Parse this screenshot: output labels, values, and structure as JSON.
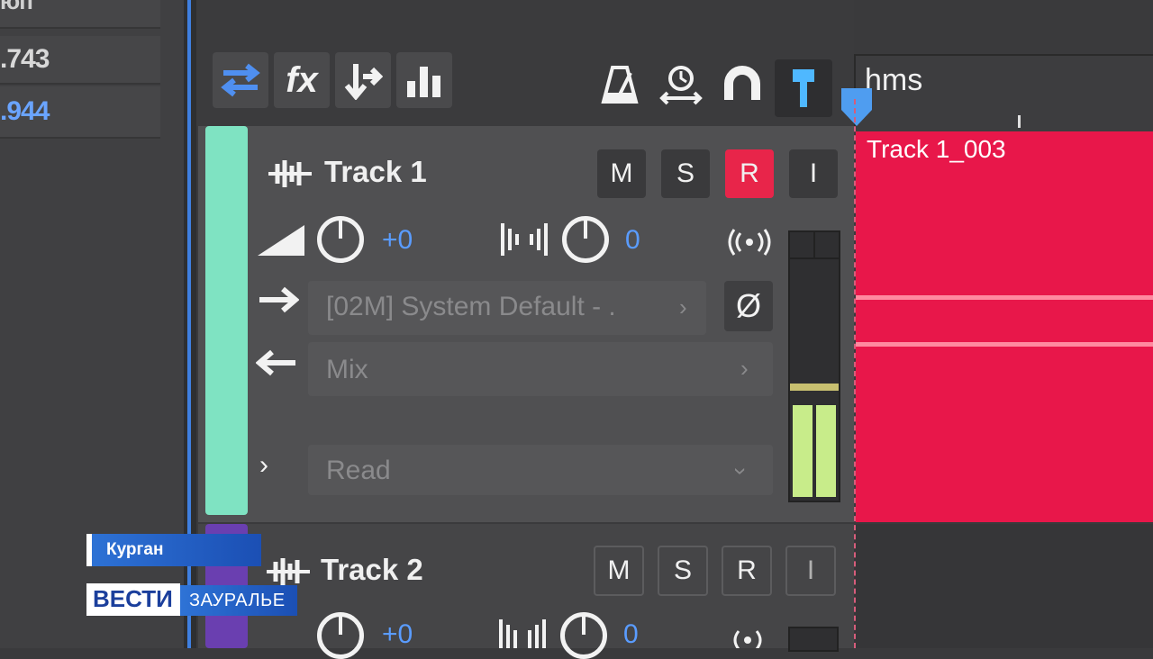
{
  "left_panel": {
    "top_fragment": "юп",
    "values": [
      ".743",
      ".944"
    ]
  },
  "toolbar": {
    "buttons": [
      "routing-icon",
      "fx-icon",
      "send-icon",
      "meter-icon"
    ],
    "fx_label": "fx",
    "tools": [
      "metronome-icon",
      "time-stretch-icon",
      "snap-magnet-icon",
      "pin-icon"
    ]
  },
  "timeline": {
    "ruler_unit": "hms",
    "clip_name": "Track 1_003",
    "clip_color": "#e8174a"
  },
  "tracks": [
    {
      "name": "Track 1",
      "color": "#7fe3c2",
      "buttons": {
        "mute": "M",
        "solo": "S",
        "record": "R",
        "input": "I"
      },
      "volume": "+0",
      "pan": "0",
      "input": "[02M] System Default - .",
      "output": "Mix",
      "automation": "Read",
      "phase_icon": "Ø"
    },
    {
      "name": "Track 2",
      "color": "#6a3fb0",
      "buttons": {
        "mute": "M",
        "solo": "S",
        "record": "R",
        "input": "I"
      },
      "volume": "+0",
      "pan": "0"
    }
  ],
  "overlay": {
    "location": "Курган",
    "channel": "ВЕСТИ",
    "region": "ЗАУРАЛЬЕ"
  }
}
